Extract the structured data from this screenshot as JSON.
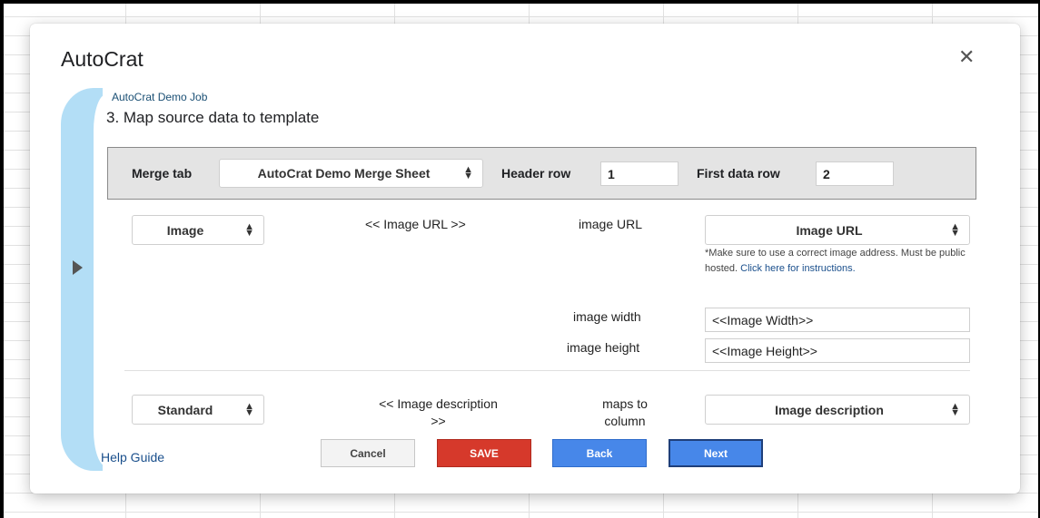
{
  "dialog": {
    "title": "AutoCrat",
    "close_glyph": "✕",
    "job_name": "AutoCrat Demo Job",
    "step_title": "3. Map source data to template"
  },
  "merge_settings": {
    "merge_tab_label": "Merge tab",
    "merge_tab_value": "AutoCrat Demo Merge Sheet",
    "header_row_label": "Header row",
    "header_row_value": "1",
    "first_data_row_label": "First data row",
    "first_data_row_value": "2"
  },
  "mappings": [
    {
      "type_value": "Image",
      "tag": "<< Image URL >>",
      "target_label": "image URL",
      "target_value": "Image URL",
      "note_text": "*Make sure to use a correct image address. Must be public hosted. ",
      "note_link": "Click here for instructions.",
      "width_label": "image width",
      "width_value": "<<Image Width>>",
      "height_label": "image height",
      "height_value": "<<Image Height>>"
    },
    {
      "type_value": "Standard",
      "tag_line1": "<< Image description",
      "tag_line2": ">>",
      "target_label_line1": "maps to",
      "target_label_line2": "column",
      "target_value": "Image description"
    }
  ],
  "footer": {
    "help_label": "Help Guide",
    "cancel_label": "Cancel",
    "save_label": "SAVE",
    "back_label": "Back",
    "next_label": "Next"
  },
  "colors": {
    "side_panel": "#b3def6",
    "save": "#d6392b",
    "primary": "#4787e9",
    "link": "#1a4f8c"
  },
  "icons": {
    "close": "close-icon",
    "expand_panel": "play-triangle-icon",
    "select_arrows": "sort-arrows-icon"
  }
}
